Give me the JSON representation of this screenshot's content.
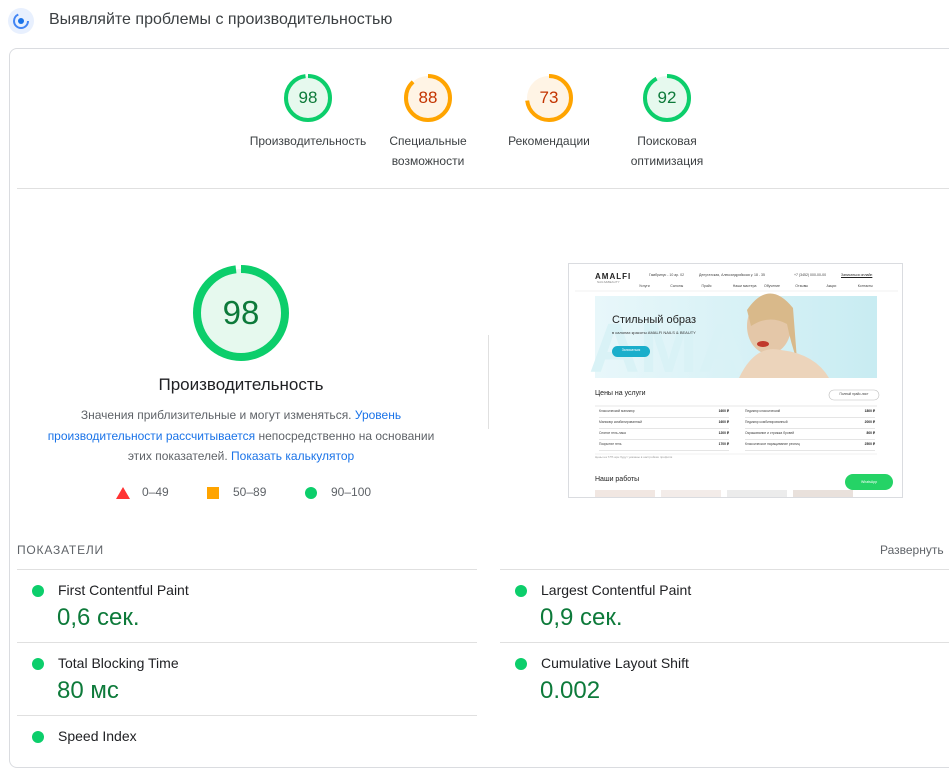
{
  "header": {
    "title": "Выявляйте проблемы с производительностью",
    "icon": "speed-insights-icon"
  },
  "categories": [
    {
      "score": "98",
      "label_line1": "Производительность",
      "label_line2": "",
      "status": "pass",
      "color": "#0cce6b",
      "text_color": "#0d7a3a",
      "fill": "#e6f9ee"
    },
    {
      "score": "88",
      "label_line1": "Специальные",
      "label_line2": "возможности",
      "status": "average",
      "color": "#ffa400",
      "text_color": "#c33300",
      "fill": "#fff4e5"
    },
    {
      "score": "73",
      "label_line1": "Рекомендации",
      "label_line2": "",
      "status": "average",
      "color": "#ffa400",
      "text_color": "#c33300",
      "fill": "#fff4e5"
    },
    {
      "score": "92",
      "label_line1": "Поисковая",
      "label_line2": "оптимизация",
      "status": "pass",
      "color": "#0cce6b",
      "text_color": "#0d7a3a",
      "fill": "#e6f9ee"
    }
  ],
  "performance": {
    "score": "98",
    "title": "Производительность",
    "desc_prefix": "Значения приблизительные и могут изменяться.",
    "desc_link1": "Уровень производительности рассчитывается",
    "desc_middle": "непосредственно на основании этих показателей.",
    "desc_link2": "Показать калькулятор"
  },
  "legend": [
    {
      "range": "0–49",
      "shape": "triangle",
      "color": "#ff3333"
    },
    {
      "range": "50–89",
      "shape": "square",
      "color": "#ffa400"
    },
    {
      "range": "90–100",
      "shape": "circle",
      "color": "#0cce6b"
    }
  ],
  "screenshot": {
    "logo": "AMALFI",
    "logo_sub": "NAILS&BEAUTY",
    "address1": "Гамбринус - 10 ар. 02",
    "address2": "Депутатская, Александрийская у. 18 - 35",
    "phone": "+7 (3452) 000-00-00",
    "cta": "Записаться онлайн",
    "nav": [
      "Услуги",
      "Салоны",
      "Прайс",
      "Наши мастера",
      "Обучение",
      "Отзывы",
      "Акции",
      "Контакты"
    ],
    "hero_title": "Стильный образ",
    "hero_sub": "в салонах красоты AMALFI NAILS & BEAUTY",
    "hero_button": "Записаться",
    "prices_title": "Цены на услуги",
    "prices_button": "Полный прайс-лист",
    "prices_left": [
      {
        "name": "Классический маникюр",
        "price": "1600 ₽"
      },
      {
        "name": "Маникюр комбинированный",
        "price": "1600 ₽"
      },
      {
        "name": "Снятие гель-лака",
        "price": "1200 ₽"
      },
      {
        "name": "Покрытие гель",
        "price": "1700 ₽"
      }
    ],
    "prices_right": [
      {
        "name": "Педикюр классический",
        "price": "1800 ₽"
      },
      {
        "name": "Педикюр комбинированный",
        "price": "2000 ₽"
      },
      {
        "name": "Окрашивание и стрижка бровей",
        "price": "800 ₽"
      },
      {
        "name": "Классическое наращивание ресниц",
        "price": "2500 ₽"
      }
    ],
    "prices_note": "Цены на ТЛТ-арн будут указаны в настройках профиля",
    "works_title": "Наши работы",
    "whatsapp_label": "WhatsApp"
  },
  "metrics": {
    "title": "ПОКАЗАТЕЛИ",
    "expand": "Развернуть",
    "items": [
      {
        "name": "First Contentful Paint",
        "value": "0,6 сек."
      },
      {
        "name": "Largest Contentful Paint",
        "value": "0,9 сек."
      },
      {
        "name": "Total Blocking Time",
        "value": "80 мс"
      },
      {
        "name": "Cumulative Layout Shift",
        "value": "0.002"
      },
      {
        "name": "Speed Index",
        "value": ""
      }
    ]
  }
}
